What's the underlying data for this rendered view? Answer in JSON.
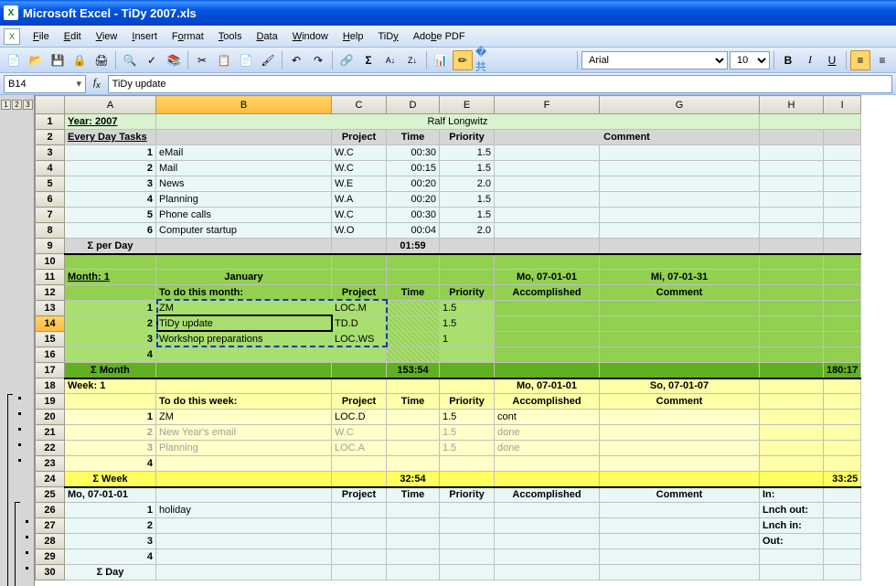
{
  "title": "Microsoft Excel - TiDy 2007.xls",
  "menu": [
    "File",
    "Edit",
    "View",
    "Insert",
    "Format",
    "Tools",
    "Data",
    "Window",
    "Help",
    "TiDy",
    "Adobe PDF"
  ],
  "font": {
    "name": "Arial",
    "size": "10"
  },
  "namebox": "B14",
  "formula": "TiDy update",
  "columns": [
    "A",
    "B",
    "C",
    "D",
    "E",
    "F",
    "G",
    "H",
    "I"
  ],
  "col_widths": {
    "A": 100,
    "B": 192,
    "C": 60,
    "D": 58,
    "E": 60,
    "F": 115,
    "G": 175,
    "H": 70,
    "I": 40
  },
  "outline": [
    "1",
    "2",
    "3"
  ],
  "year_label": "Year:  2007",
  "author": "Ralf Longwitz",
  "every_day_header": {
    "label": "Every Day Tasks",
    "project": "Project",
    "time": "Time",
    "priority": "Priority",
    "comment": "Comment"
  },
  "tasks": [
    {
      "n": "1",
      "name": "eMail",
      "proj": "W.C",
      "time": "00:30",
      "prio": "1.5"
    },
    {
      "n": "2",
      "name": "Mail",
      "proj": "W.C",
      "time": "00:15",
      "prio": "1.5"
    },
    {
      "n": "3",
      "name": "News",
      "proj": "W.E",
      "time": "00:20",
      "prio": "2.0"
    },
    {
      "n": "4",
      "name": "Planning",
      "proj": "W.A",
      "time": "00:20",
      "prio": "1.5"
    },
    {
      "n": "5",
      "name": "Phone calls",
      "proj": "W.C",
      "time": "00:30",
      "prio": "1.5"
    },
    {
      "n": "6",
      "name": "Computer startup",
      "proj": "W.O",
      "time": "00:04",
      "prio": "2.0"
    }
  ],
  "sum_per_day": {
    "label": "Σ per Day",
    "time": "01:59"
  },
  "month": {
    "label": "Month:  1",
    "name": "January",
    "start": "Mo, 07-01-01",
    "end": "Mi, 07-01-31"
  },
  "month_hdr": {
    "todo": "To do this month:",
    "project": "Project",
    "time": "Time",
    "priority": "Priority",
    "accomp": "Accomplished",
    "comment": "Comment"
  },
  "month_todos": [
    {
      "n": "1",
      "name": "ZM",
      "proj": "LOC.M",
      "time": "",
      "prio": "1.5"
    },
    {
      "n": "2",
      "name": "TiDy update",
      "proj": "TD.D",
      "time": "",
      "prio": "1.5"
    },
    {
      "n": "3",
      "name": "Workshop preparations",
      "proj": "LOC.WS",
      "time": "",
      "prio": "1"
    },
    {
      "n": "4",
      "name": "",
      "proj": "",
      "time": "",
      "prio": ""
    }
  ],
  "sum_month": {
    "label": "Σ Month",
    "time": "153:54",
    "total": "180:17"
  },
  "week": {
    "label": "Week: 1",
    "start": "Mo, 07-01-01",
    "end": "So, 07-01-07"
  },
  "week_hdr": {
    "todo": "To do this week:",
    "project": "Project",
    "time": "Time",
    "priority": "Priority",
    "accomp": "Accomplished",
    "comment": "Comment"
  },
  "week_todos": [
    {
      "n": "1",
      "name": "ZM",
      "proj": "LOC.D",
      "time": "",
      "prio": "1.5",
      "acc": "cont",
      "done": false
    },
    {
      "n": "2",
      "name": "New Year's email",
      "proj": "W.C",
      "time": "",
      "prio": "1.5",
      "acc": "done",
      "done": true
    },
    {
      "n": "3",
      "name": "Planning",
      "proj": "LOC.A",
      "time": "",
      "prio": "1.5",
      "acc": "done",
      "done": true
    },
    {
      "n": "4",
      "name": "",
      "proj": "",
      "time": "",
      "prio": "",
      "acc": "",
      "done": false
    }
  ],
  "sum_week": {
    "label": "Σ Week",
    "time": "32:54",
    "total": "33:25"
  },
  "day": {
    "label": "Mo, 07-01-01",
    "project": "Project",
    "time": "Time",
    "priority": "Priority",
    "accomp": "Accomplished",
    "comment": "Comment",
    "in": "In:",
    "lout": "Lnch out:",
    "lin": "Lnch in:",
    "out": "Out:"
  },
  "day_rows": [
    {
      "n": "1",
      "name": "holiday"
    },
    {
      "n": "2",
      "name": ""
    },
    {
      "n": "3",
      "name": ""
    },
    {
      "n": "4",
      "name": ""
    }
  ],
  "sum_day": {
    "label": "Σ Day"
  },
  "active_cell": {
    "row": 14,
    "col": "B"
  },
  "chart_data": null
}
